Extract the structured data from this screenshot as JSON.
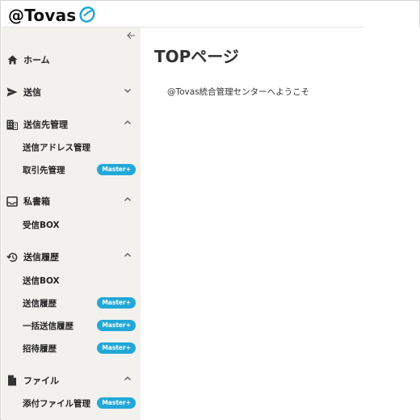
{
  "header": {
    "logo_text": "@Tovas",
    "logo_mark_icon": "tovas-logo-mark"
  },
  "sidebar": {
    "collapse_icon": "arrow-left-icon",
    "items": [
      {
        "label": "ホーム",
        "icon": "home-icon"
      },
      {
        "label": "送信",
        "icon": "send-icon",
        "chevron": "down"
      },
      {
        "label": "送信先管理",
        "icon": "building-icon",
        "chevron": "up",
        "children": [
          {
            "label": "送信アドレス管理"
          },
          {
            "label": "取引先管理",
            "badge": "Master+"
          }
        ]
      },
      {
        "label": "私書箱",
        "icon": "inbox-icon",
        "chevron": "up",
        "children": [
          {
            "label": "受信BOX"
          }
        ]
      },
      {
        "label": "送信履歴",
        "icon": "history-icon",
        "chevron": "up",
        "children": [
          {
            "label": "送信BOX"
          },
          {
            "label": "送信履歴",
            "badge": "Master+"
          },
          {
            "label": "一括送信履歴",
            "badge": "Master+"
          },
          {
            "label": "招待履歴",
            "badge": "Master+"
          }
        ]
      },
      {
        "label": "ファイル",
        "icon": "file-icon",
        "chevron": "up",
        "children": [
          {
            "label": "添付ファイル管理",
            "badge": "Master+"
          }
        ]
      }
    ]
  },
  "main": {
    "title": "TOPページ",
    "welcome": "@Tovas統合管理センターへようこそ"
  },
  "colors": {
    "sidebar_bg": "#f2f1ee",
    "badge_bg": "#22a8d8",
    "logo_accent": "#1aa6d6"
  }
}
